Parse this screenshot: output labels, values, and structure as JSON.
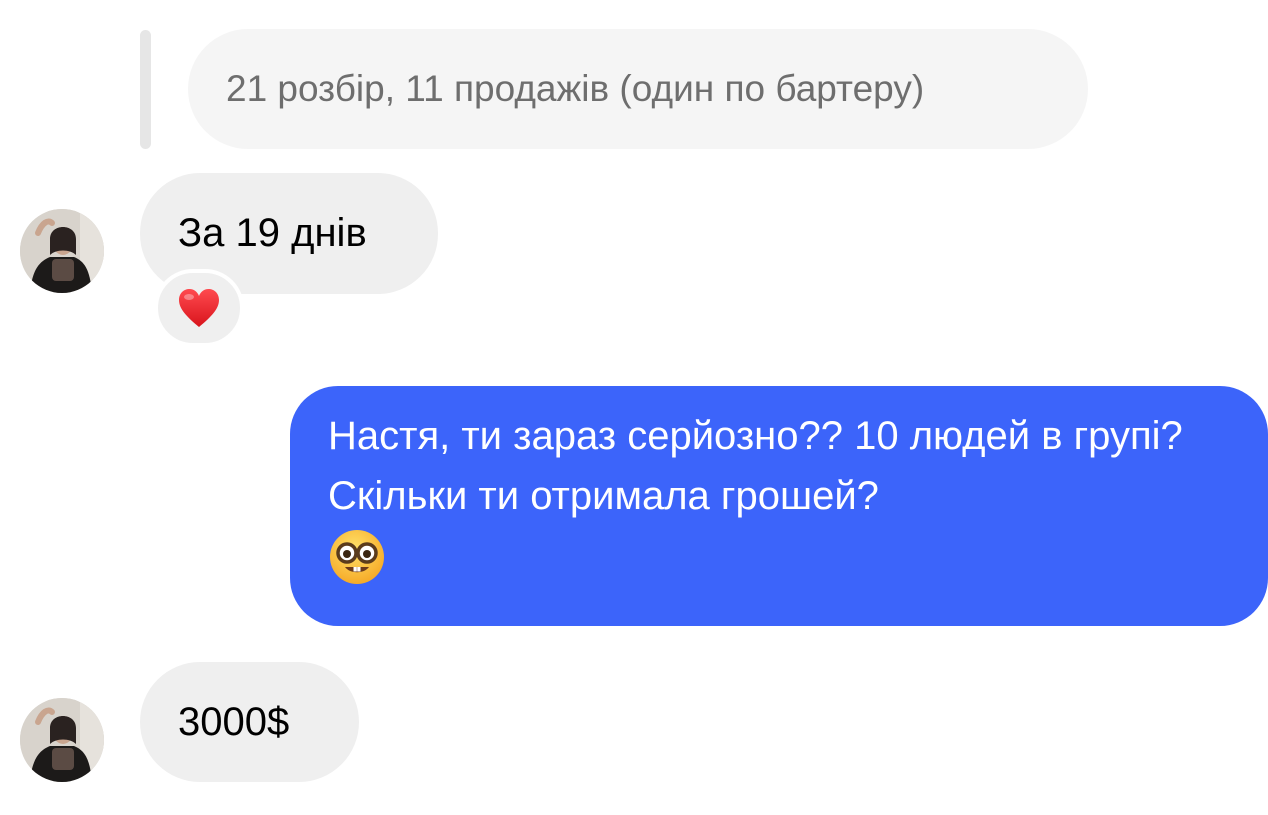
{
  "conversation": {
    "quoted_reply": {
      "text": "21 розбір, 11 продажів (один по бартеру)"
    },
    "messages": [
      {
        "direction": "incoming",
        "text": "За 19 днів",
        "reaction": "heart-emoji"
      },
      {
        "direction": "outgoing",
        "text": "Настя, ти зараз серйозно?? 10 людей в групі? Скільки ти отримала грошей?",
        "emoji": "nerd-face-emoji"
      },
      {
        "direction": "incoming",
        "text": "3000$"
      }
    ]
  },
  "colors": {
    "outgoing_bubble": "#3c64fa",
    "incoming_bubble": "#efefef",
    "quoted_bubble": "#f5f5f5",
    "reaction_heart": "#e8202a"
  }
}
